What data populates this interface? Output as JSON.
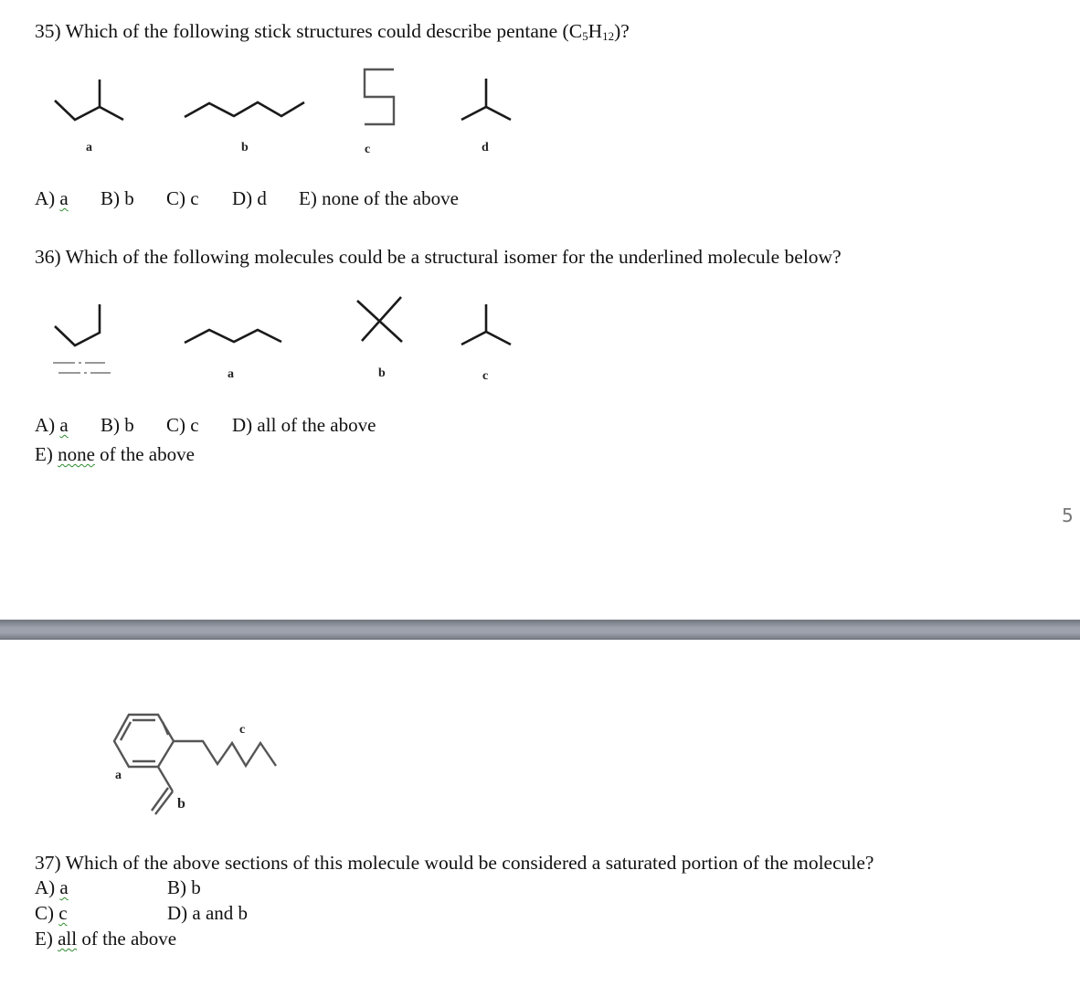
{
  "page_number": "5",
  "q35": {
    "prefix": "35) Which of the following stick structures could describe pentane (C",
    "sub1": "5",
    "mid": "H",
    "sub2": "12",
    "suffix": ")?",
    "structure_labels": [
      "a",
      "b",
      "c",
      "d"
    ],
    "answers": {
      "A": {
        "prefix": "A) ",
        "value": "a"
      },
      "B": "B) b",
      "C": "C) c",
      "D": "D) d",
      "E": "E) none of the above"
    }
  },
  "q36": {
    "question": "36) Which of the following molecules could be a structural isomer for the underlined molecule below?",
    "structure_labels": [
      "a",
      "b",
      "c"
    ],
    "answers": {
      "A": {
        "prefix": "A) ",
        "value": "a"
      },
      "B": "B) b",
      "C": "C) c",
      "D": "D) all of the above",
      "E": {
        "prefix": "E) ",
        "flagged": "none",
        "suffix": " of the above"
      }
    }
  },
  "q37": {
    "question": "37) Which of the above sections of this molecule would be considered a saturated portion of the molecule?",
    "molecule_labels": {
      "a": "a",
      "b": "b",
      "c": "c"
    },
    "answers": {
      "A": {
        "prefix": "A) ",
        "value": "a"
      },
      "B": "B) b",
      "C": {
        "prefix": "C) ",
        "value": "c"
      },
      "D": "D) a and b",
      "E": {
        "prefix": "E) ",
        "flagged": "all",
        "suffix": " of the above"
      }
    }
  },
  "colors": {
    "spellcheck_underline": "#2e8b2e",
    "page_divider": "#9da2ac",
    "page_number": "#777777"
  }
}
